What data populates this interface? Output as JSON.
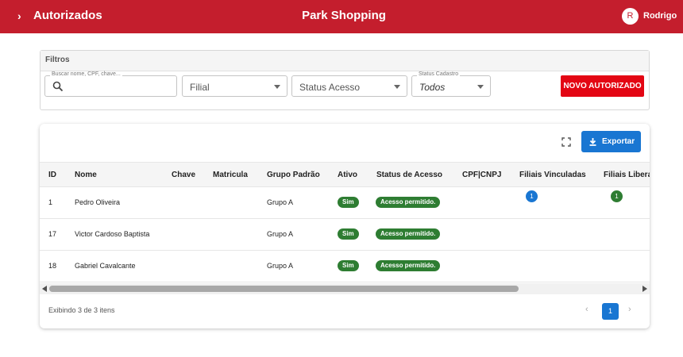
{
  "header": {
    "back_icon": "chevron-right-icon",
    "section": "Autorizados",
    "location": "Park Shopping",
    "avatar_initial": "R",
    "user_name": "Rodrigo",
    "bg_color": "#c41e2d"
  },
  "filters": {
    "title": "Filtros",
    "search": {
      "label": "Buscar nome, CPF, chave...",
      "value": ""
    },
    "filial": {
      "value": "Filial"
    },
    "status_acesso": {
      "value": "Status Acesso"
    },
    "status_cadastro": {
      "label": "Status Cadastro",
      "value": "Todos"
    },
    "new_button": "NOVO AUTORIZADO"
  },
  "toolbar": {
    "export_label": "Exportar"
  },
  "table": {
    "columns": [
      "ID",
      "Nome",
      "Chave",
      "Matricula",
      "Grupo Padrão",
      "Ativo",
      "Status de Acesso",
      "CPF|CNPJ",
      "Filiais Vinculadas",
      "Filiais Liberadas"
    ],
    "rows": [
      {
        "id": "1",
        "nome": "Pedro Oliveira",
        "chave": "",
        "matricula": "",
        "grupo": "Grupo A",
        "ativo": "Sim",
        "status": "Acesso permitido.",
        "cpf": "",
        "vinculadas": "1",
        "liberadas": "1"
      },
      {
        "id": "17",
        "nome": "Victor Cardoso Baptista",
        "chave": "",
        "matricula": "",
        "grupo": "Grupo A",
        "ativo": "Sim",
        "status": "Acesso permitido.",
        "cpf": "",
        "vinculadas": "",
        "liberadas": ""
      },
      {
        "id": "18",
        "nome": "Gabriel Cavalcante",
        "chave": "",
        "matricula": "",
        "grupo": "Grupo A",
        "ativo": "Sim",
        "status": "Acesso permitido.",
        "cpf": "",
        "vinculadas": "",
        "liberadas": ""
      }
    ]
  },
  "footer": {
    "summary": "Exibindo 3 de 3 itens",
    "prev": "‹",
    "current_page": "1",
    "next": "›"
  },
  "colors": {
    "primary_red": "#e30613",
    "blue": "#1976d2",
    "green": "#2e7d32"
  }
}
